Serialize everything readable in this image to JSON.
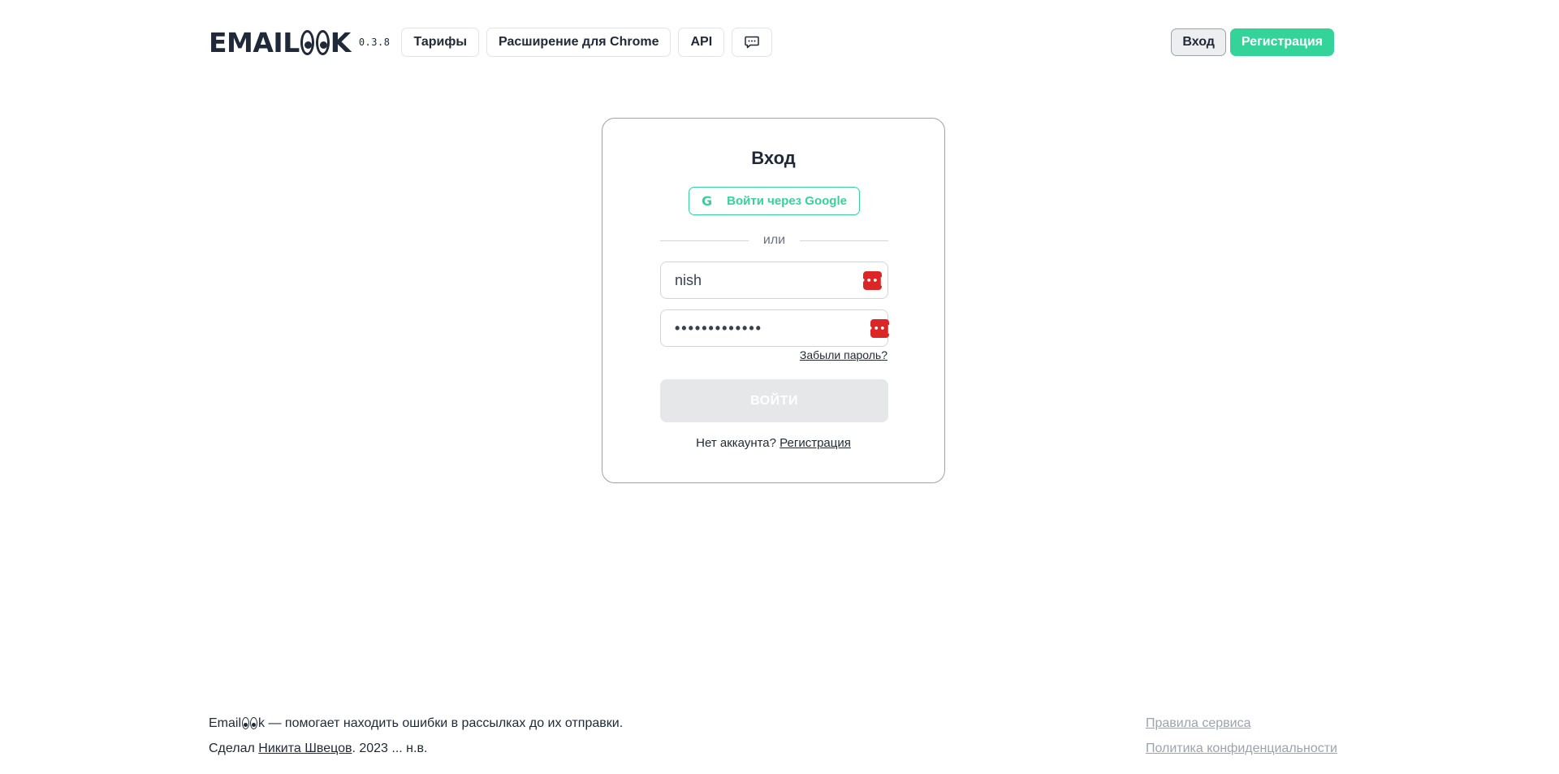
{
  "header": {
    "logo_left": "EMAIL",
    "logo_right": "K",
    "version": "0.3.8",
    "nav": [
      {
        "label": "Тарифы"
      },
      {
        "label": "Расширение для Chrome"
      },
      {
        "label": "API"
      }
    ],
    "login_label": "Вход",
    "register_label": "Регистрация"
  },
  "login_form": {
    "title": "Вход",
    "google_label": "Войти через Google",
    "google_glyph": "G",
    "divider_text": "или",
    "username_value": "nish",
    "password_value": "•••••••••••••",
    "forgot_label": "Забыли пароль?",
    "submit_label": "ВОЙТИ",
    "no_account_text": "Нет аккаунта?",
    "register_link": "Регистрация"
  },
  "footer": {
    "brand_left": "Email",
    "brand_right": "k",
    "tagline": " — помогает находить ошибки в рассылках до их отправки.",
    "made_by_prefix": "Сделал ",
    "author": "Никита Швецов",
    "years": ". 2023 ... н.в.",
    "terms": "Правила сервиса",
    "privacy": "Политика конфиденциальности"
  },
  "colors": {
    "accent": "#34d399",
    "password_manager": "#dc2626",
    "text": "#1f2937"
  }
}
